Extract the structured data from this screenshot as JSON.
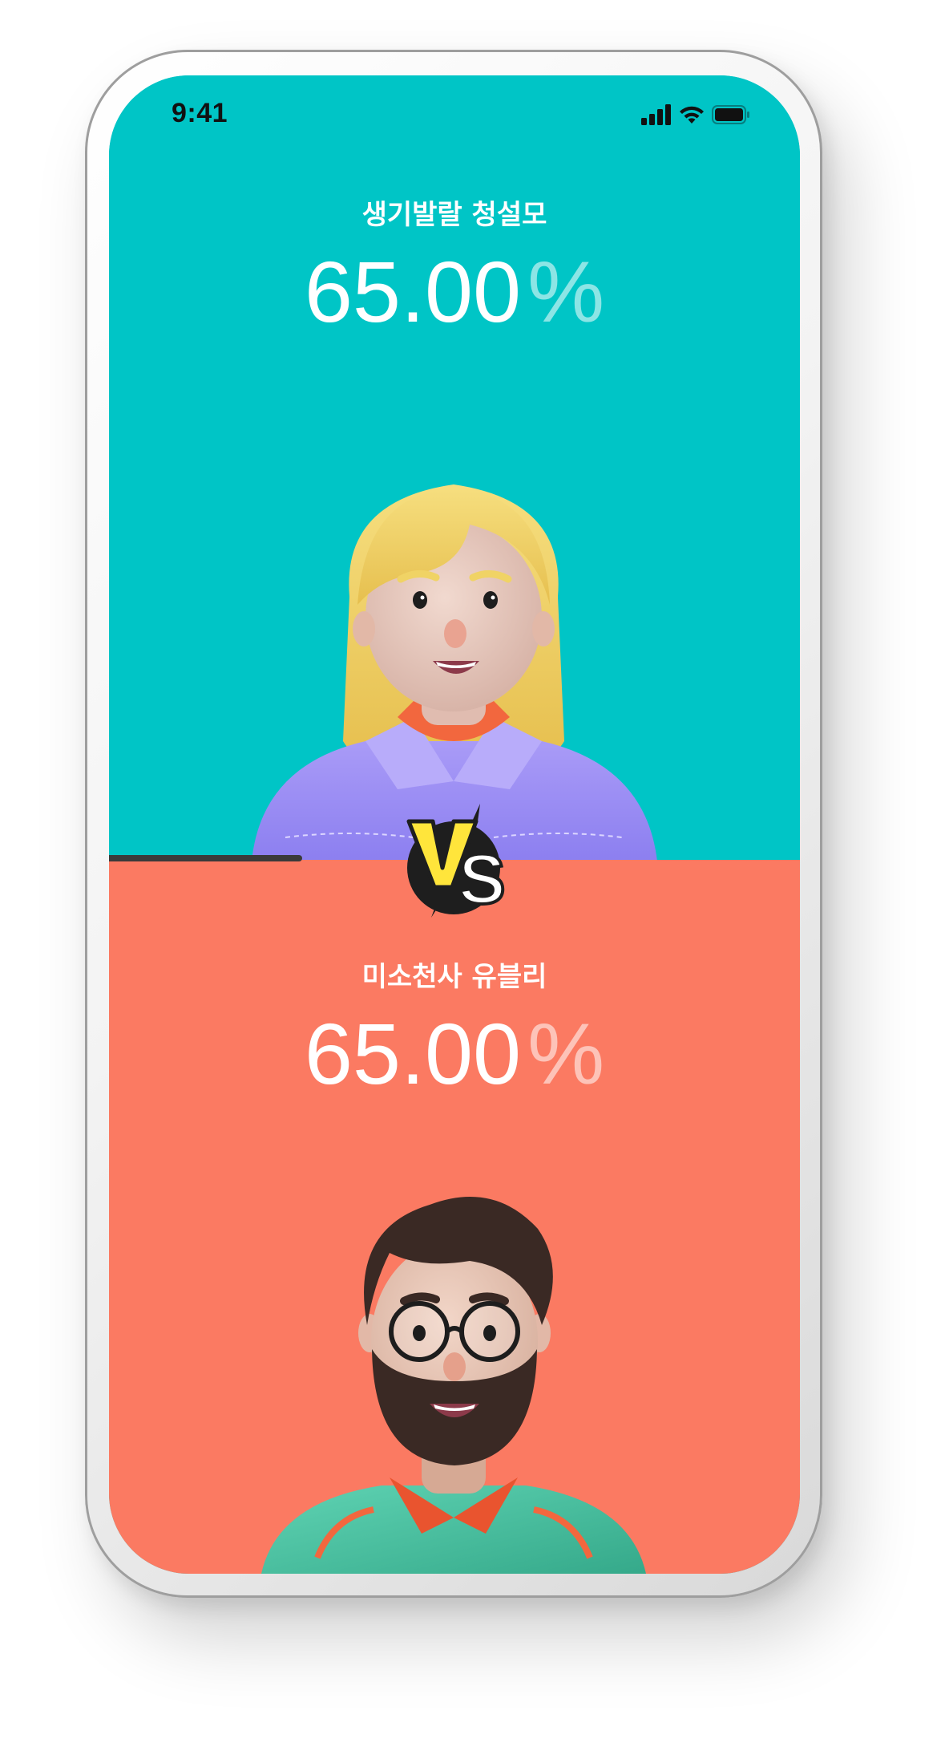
{
  "status_bar": {
    "time": "9:41",
    "icons": [
      "cellular-signal-icon",
      "wifi-icon",
      "battery-icon"
    ]
  },
  "top_contestant": {
    "name": "생기발랄 청설모",
    "percent_value": "65.00",
    "percent_sign": "%",
    "avatar": "blonde-woman-avatar",
    "background": "#00c5c6"
  },
  "bottom_contestant": {
    "name": "미소천사 유블리",
    "percent_value": "65.00",
    "percent_sign": "%",
    "avatar": "bearded-man-avatar",
    "background": "#fb7a62"
  },
  "vs_badge": {
    "icon": "vs-lightning-badge-icon",
    "colors": {
      "v": "#ffe53b",
      "s": "#ffffff",
      "circle": "#1e1e1e"
    }
  },
  "progress": {
    "fraction": 0.28,
    "color": "#3a3a3a"
  }
}
